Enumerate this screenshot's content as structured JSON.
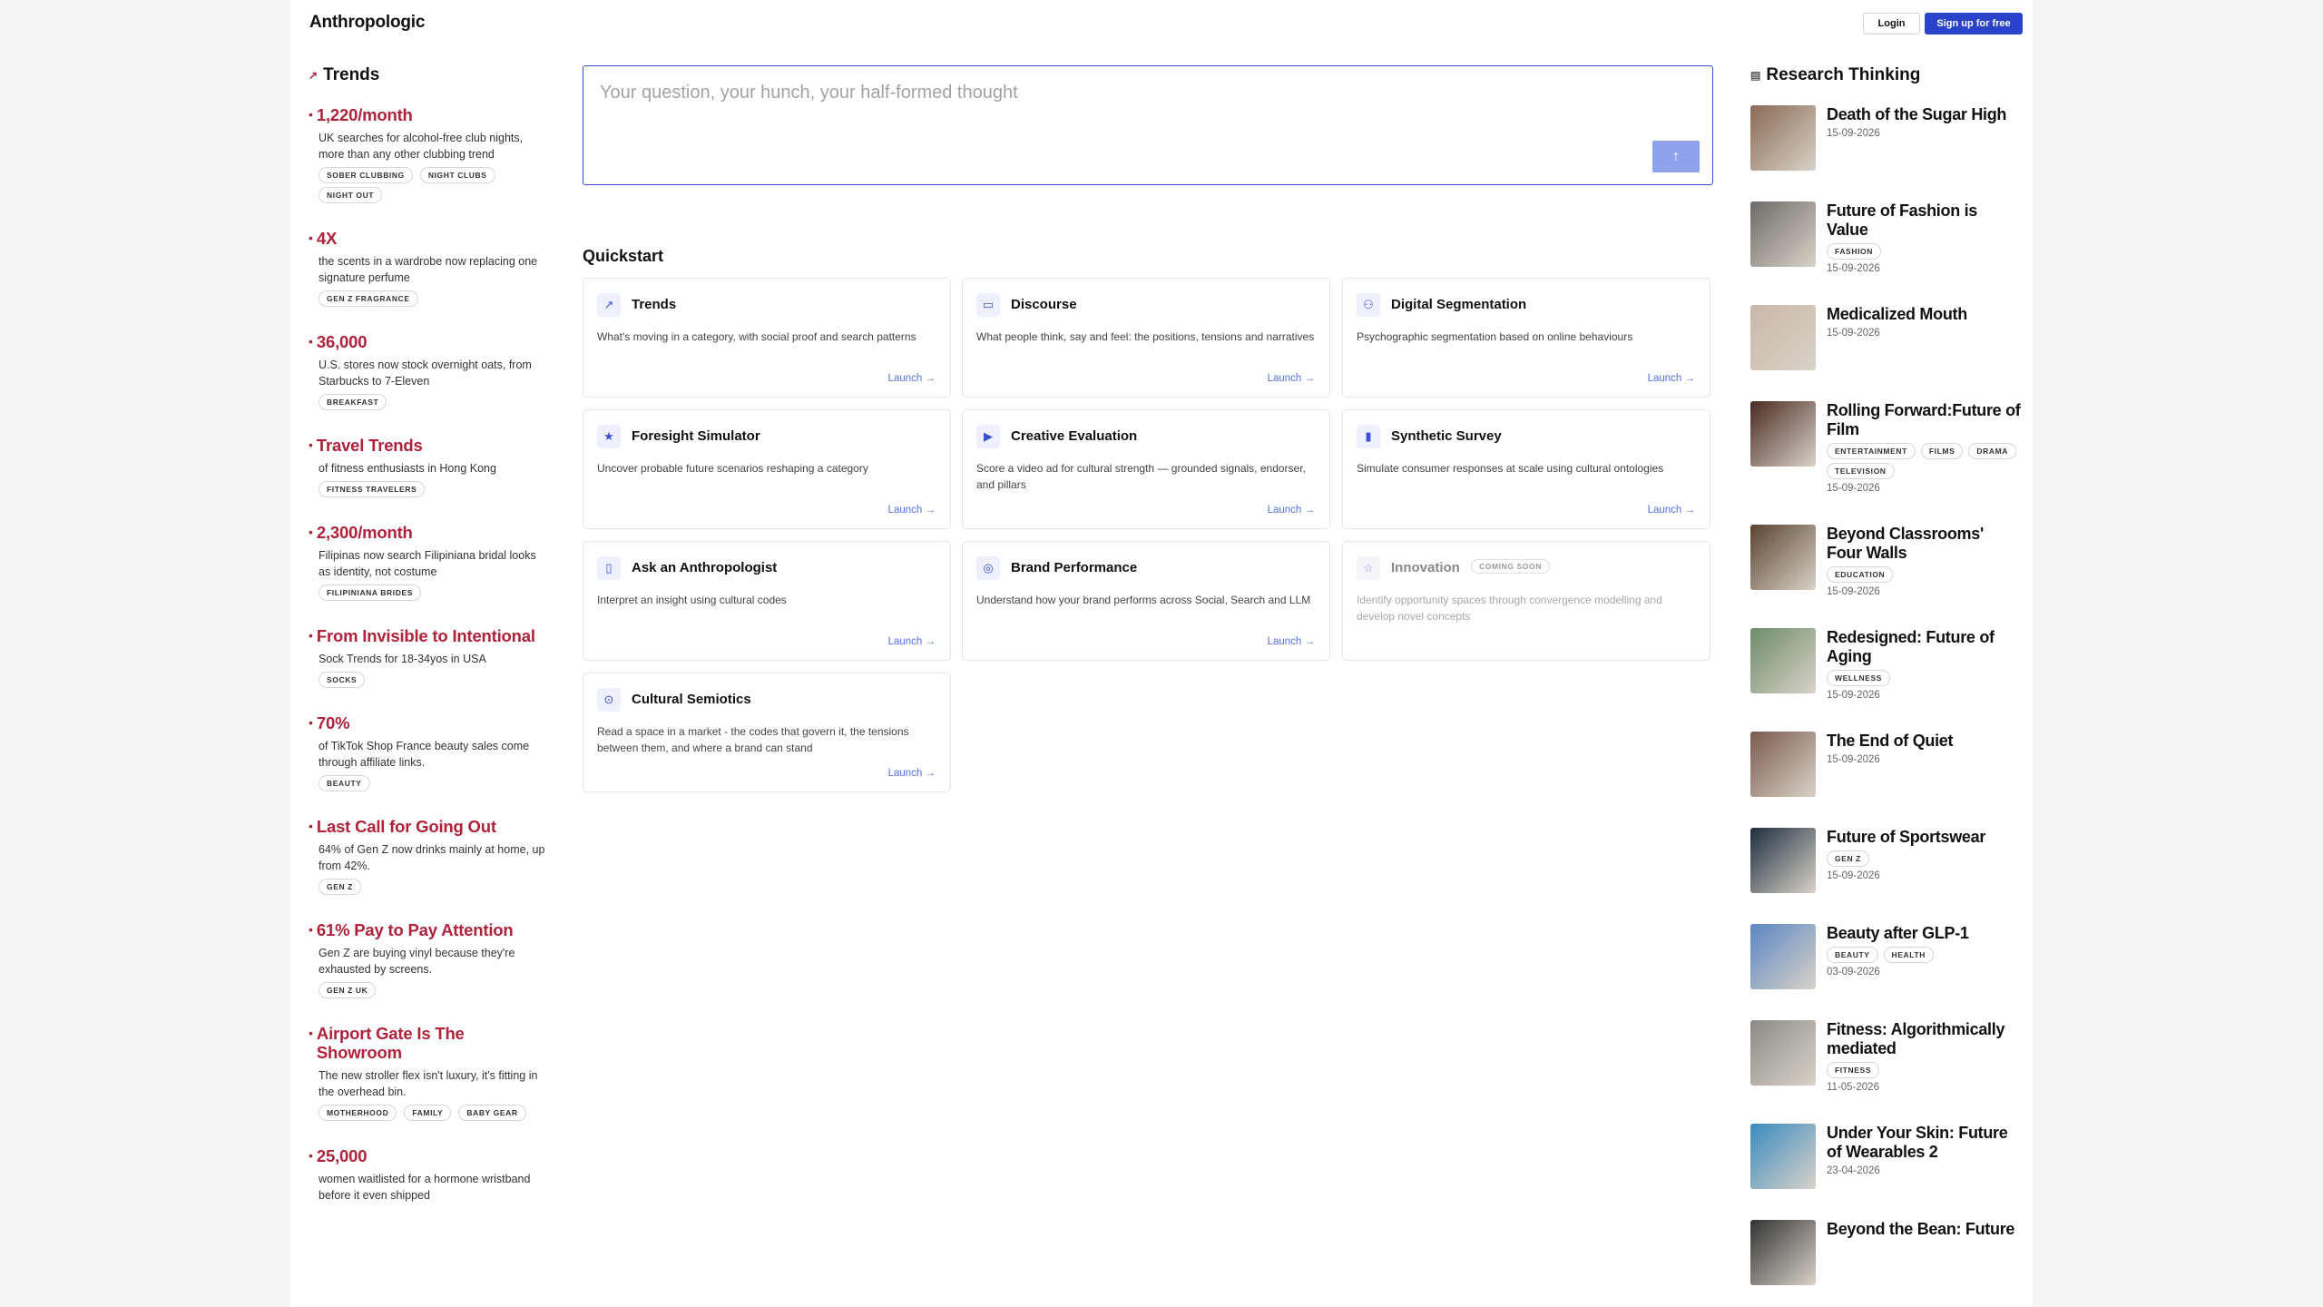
{
  "header": {
    "brand": "Anthropologic",
    "login": "Login",
    "signup": "Sign up for free"
  },
  "trends": {
    "title": "Trends",
    "items": [
      {
        "value": "1,220/month",
        "desc": "UK searches for alcohol-free club nights, more than any other clubbing trend",
        "tags": [
          "SOBER CLUBBING",
          "NIGHT CLUBS",
          "NIGHT OUT"
        ]
      },
      {
        "value": "4X",
        "desc": "the scents in a wardrobe now replacing one signature perfume",
        "tags": [
          "GEN Z FRAGRANCE"
        ]
      },
      {
        "value": "36,000",
        "desc": "U.S. stores now stock overnight oats, from Starbucks to 7-Eleven",
        "tags": [
          "BREAKFAST"
        ]
      },
      {
        "value": "Travel Trends",
        "desc": "of fitness enthusiasts in Hong Kong",
        "tags": [
          "FITNESS TRAVELERS"
        ]
      },
      {
        "value": "2,300/month",
        "desc": "Filipinas now search Filipiniana bridal looks as identity, not costume",
        "tags": [
          "FILIPINIANA BRIDES"
        ]
      },
      {
        "value": "From Invisible to Intentional",
        "desc": "Sock Trends for 18-34yos in USA",
        "tags": [
          "SOCKS"
        ]
      },
      {
        "value": "70%",
        "desc": "of TikTok Shop France beauty sales come through affiliate links.",
        "tags": [
          "BEAUTY"
        ]
      },
      {
        "value": "Last Call for Going Out",
        "desc": "64% of Gen Z now drinks mainly at home, up from 42%.",
        "tags": [
          "GEN Z"
        ]
      },
      {
        "value": "61% Pay to Pay Attention",
        "desc": "Gen Z are buying vinyl because they're exhausted by screens.",
        "tags": [
          "GEN Z UK"
        ]
      },
      {
        "value": "Airport Gate Is The Showroom",
        "desc": "The new stroller flex isn't luxury, it's fitting in the overhead bin.",
        "tags": [
          "MOTHERHOOD",
          "FAMILY",
          "BABY GEAR"
        ]
      },
      {
        "value": "25,000",
        "desc": "women waitlisted for a hormone wristband before it even shipped",
        "tags": []
      }
    ]
  },
  "search": {
    "placeholder": "Your question, your hunch, your half-formed thought",
    "send_icon": "arrow-up-icon"
  },
  "quickstart": {
    "title": "Quickstart",
    "launch_label": "Launch →",
    "coming_soon_label": "COMING SOON",
    "cards": [
      {
        "title": "Trends",
        "desc": "What's moving in a category, with social proof and search patterns",
        "icon": "↗",
        "icon_name": "trending-up-icon"
      },
      {
        "title": "Discourse",
        "desc": "What people think, say and feel: the positions, tensions and narratives",
        "icon": "▭",
        "icon_name": "chat-bubble-icon"
      },
      {
        "title": "Digital Segmentation",
        "desc": "Psychographic segmentation based on online behaviours",
        "icon": "⚇",
        "icon_name": "users-icon"
      },
      {
        "title": "Foresight Simulator",
        "desc": "Uncover probable future scenarios reshaping a category",
        "icon": "★",
        "icon_name": "sparkle-icon"
      },
      {
        "title": "Creative Evaluation",
        "desc": "Score a video ad for cultural strength — grounded signals, endorser, and pillars",
        "icon": "▶",
        "icon_name": "video-icon"
      },
      {
        "title": "Synthetic Survey",
        "desc": "Simulate consumer responses at scale using cultural ontologies",
        "icon": "▮",
        "icon_name": "bar-chart-icon"
      },
      {
        "title": "Ask an Anthropologist",
        "desc": "Interpret an insight using cultural codes",
        "icon": "▯",
        "icon_name": "book-icon"
      },
      {
        "title": "Brand Performance",
        "desc": "Understand how your brand performs across Social, Search and LLM",
        "icon": "◎",
        "icon_name": "target-icon"
      },
      {
        "title": "Innovation",
        "desc": "Identify opportunity spaces through convergence modelling and develop novel concepts",
        "icon": "☆",
        "icon_name": "star-icon",
        "coming_soon": true
      },
      {
        "title": "Cultural Semiotics",
        "desc": "Read a space in a market - the codes that govern it, the tensions between them, and where a brand can stand",
        "icon": "⊙",
        "icon_name": "eye-icon"
      }
    ]
  },
  "research": {
    "title": "Research Thinking",
    "articles": [
      {
        "title": "Death of the Sugar High",
        "tags": [],
        "date": "15-09-2026",
        "color": "#8a6a55"
      },
      {
        "title": "Future of Fashion is Value",
        "tags": [
          "FASHION"
        ],
        "date": "15-09-2026",
        "color": "#6e6a66"
      },
      {
        "title": "Medicalized Mouth",
        "tags": [],
        "date": "15-09-2026",
        "color": "#c9b8a8"
      },
      {
        "title": "Rolling Forward:Future of Film",
        "tags": [
          "ENTERTAINMENT",
          "FILMS",
          "DRAMA",
          "TELEVISION"
        ],
        "date": "15-09-2026",
        "color": "#4a2b24"
      },
      {
        "title": "Beyond Classrooms' Four Walls",
        "tags": [
          "EDUCATION"
        ],
        "date": "15-09-2026",
        "color": "#5b4330"
      },
      {
        "title": "Redesigned: Future of Aging",
        "tags": [
          "WELLNESS"
        ],
        "date": "15-09-2026",
        "color": "#6d8b6a"
      },
      {
        "title": "The End of Quiet",
        "tags": [],
        "date": "15-09-2026",
        "color": "#7a5a4e"
      },
      {
        "title": "Future of Sportswear",
        "tags": [
          "GEN Z"
        ],
        "date": "15-09-2026",
        "color": "#1e2e40"
      },
      {
        "title": "Beauty after GLP-1",
        "tags": [
          "BEAUTY",
          "HEALTH"
        ],
        "date": "03-09-2026",
        "color": "#5a86c4"
      },
      {
        "title": "Fitness: Algorithmically mediated",
        "tags": [
          "FITNESS"
        ],
        "date": "11-05-2026",
        "color": "#8c8a86"
      },
      {
        "title": "Under Your Skin: Future of Wearables 2",
        "tags": [],
        "date": "23-04-2026",
        "color": "#3a8bc0"
      },
      {
        "title": "Beyond the Bean: Future",
        "tags": [],
        "date": "",
        "color": "#333333"
      }
    ]
  }
}
